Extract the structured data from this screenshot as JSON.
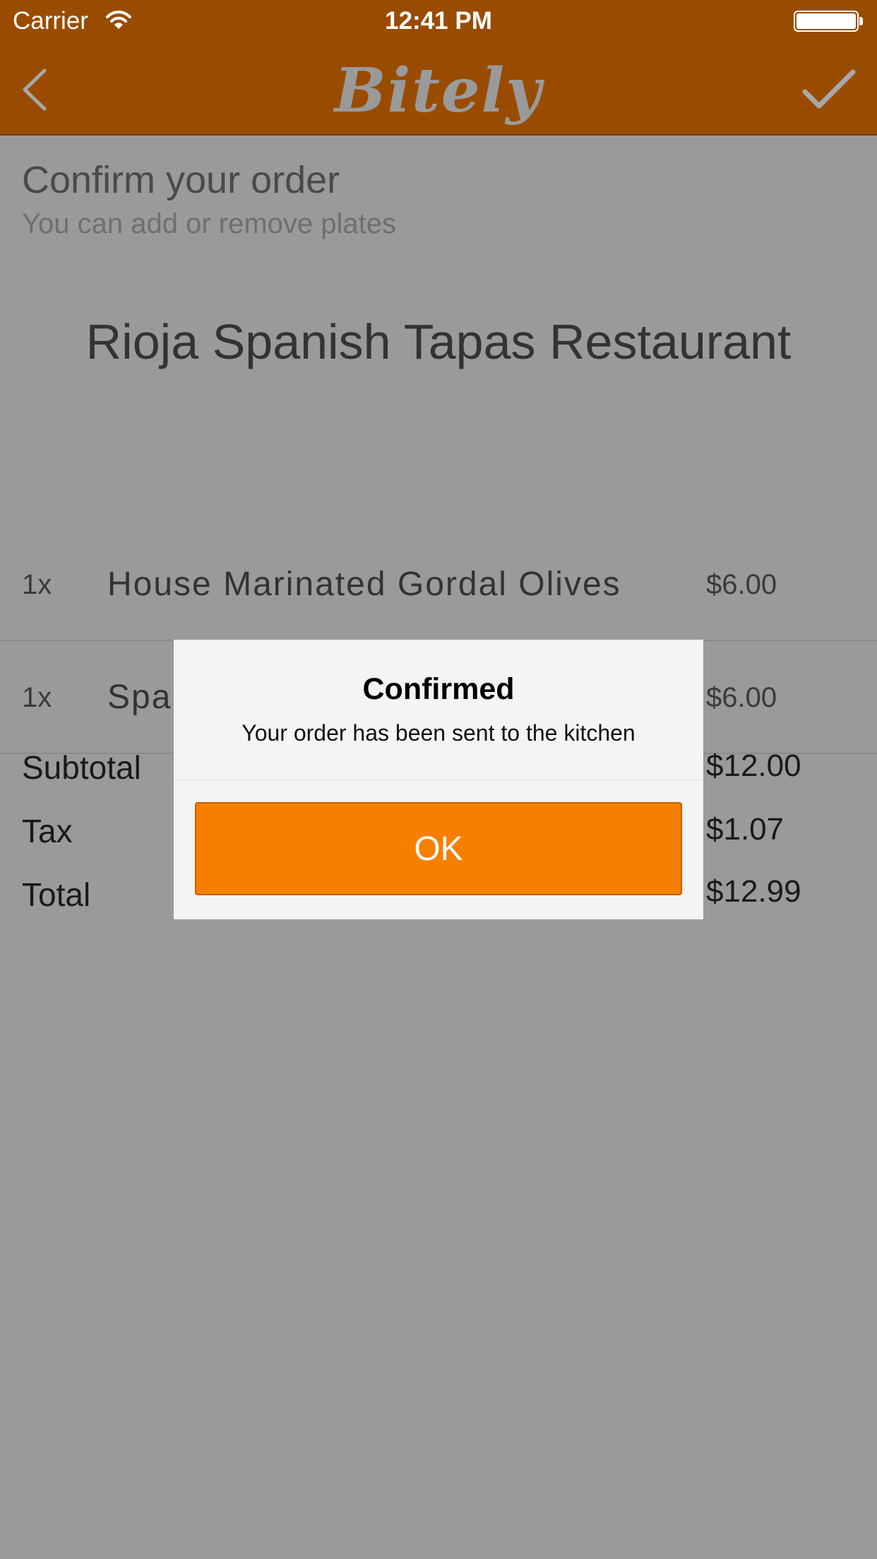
{
  "status_bar": {
    "carrier": "Carrier",
    "time": "12:41 PM"
  },
  "nav": {
    "logo": "Bitely",
    "back_icon": "chevron-left-icon",
    "confirm_icon": "checkmark-icon"
  },
  "page": {
    "title": "Confirm your order",
    "subtitle": "You can add or remove plates",
    "restaurant": "Rioja Spanish Tapas Restaurant"
  },
  "items": [
    {
      "qty": "1x",
      "name": "House Marinated Gordal Olives",
      "price": "$6.00"
    },
    {
      "qty": "1x",
      "name": "Spanish Serrano Ham",
      "price": "$6.00"
    }
  ],
  "summary": {
    "subtotal_label": "Subtotal",
    "subtotal_value": "$12.00",
    "tax_label": "Tax",
    "tax_value": "$1.07",
    "total_label": "Total",
    "total_value": "$12.99"
  },
  "alert": {
    "title": "Confirmed",
    "message": "Your order has been sent to the kitchen",
    "ok_label": "OK"
  },
  "colors": {
    "header": "#994c00",
    "accent": "#f77f00",
    "backdrop": "#9a9a9a"
  }
}
